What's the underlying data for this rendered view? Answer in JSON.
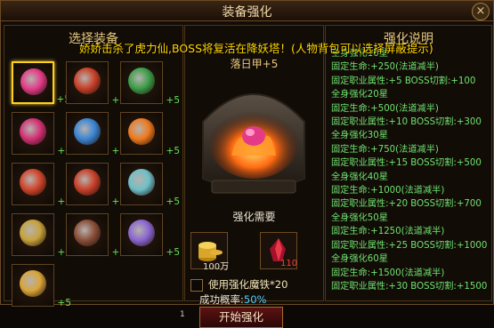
{
  "window": {
    "title": "装备强化",
    "close_label": "×"
  },
  "left_panel": {
    "title": "选择装备"
  },
  "notice": "娇娇击杀了虎力仙,BOSS将复活在降妖塔！(人物背包可以选择屏蔽提示)",
  "items": [
    {
      "icon": "pink-ring-icon",
      "level": "+5",
      "color": "#e43b88",
      "selected": true
    },
    {
      "icon": "red-bracelet-icon",
      "level": "+5",
      "color": "#c8412a",
      "selected": false
    },
    {
      "icon": "green-amulet-icon",
      "level": "+5",
      "color": "#3d9e4a",
      "selected": false
    },
    {
      "icon": "pink-necklace-icon",
      "level": "+5",
      "color": "#d33275",
      "selected": false
    },
    {
      "icon": "blue-orb-icon",
      "level": "+5",
      "color": "#3b86d4",
      "selected": false
    },
    {
      "icon": "flame-orb-icon",
      "level": "+5",
      "color": "#ef7a1f",
      "selected": false
    },
    {
      "icon": "red-bracelet-icon",
      "level": "+5",
      "color": "#d1452c",
      "selected": false
    },
    {
      "icon": "red-bracelet-icon",
      "level": "+5",
      "color": "#c8412a",
      "selected": false
    },
    {
      "icon": "ice-armor-icon",
      "level": "+5",
      "color": "#6fc0c8",
      "selected": false
    },
    {
      "icon": "gold-boots-icon",
      "level": "+5",
      "color": "#c7a23c",
      "selected": false
    },
    {
      "icon": "dark-boots-icon",
      "level": "+5",
      "color": "#8a4f3a",
      "selected": false
    },
    {
      "icon": "wing-helmet-icon",
      "level": "+5",
      "color": "#8b66d1",
      "selected": false
    },
    {
      "icon": "gold-weapon-icon",
      "level": "+5",
      "color": "#d9a53a",
      "selected": false
    }
  ],
  "middle_panel": {
    "tab_label": "落日甲+5",
    "need_label": "强化需要",
    "material_1": {
      "icon": "gold-coins-icon",
      "value": "100万",
      "value_color": "#e9e2d2"
    },
    "material_2": {
      "icon": "red-crystal-icon",
      "value": "110",
      "value_color": "#ff3b3b"
    },
    "checkbox_label": "使用强化魔铁*20",
    "rate_label": "成功概率:",
    "rate_value": "50%",
    "enhance_button": "开始强化",
    "index_label": "1"
  },
  "right_panel": {
    "title": "强化说明",
    "lines": [
      "全身强化10星",
      "固定生命:+250(法道减半)",
      "固定职业属性:+5    BOSS切割:+100",
      "全身强化20星",
      "固定生命:+500(法道减半)",
      "固定职业属性:+10   BOSS切割:+300",
      "全身强化30星",
      "固定生命:+750(法道减半)",
      "固定职业属性:+15   BOSS切割:+500",
      "全身强化40星",
      "固定生命:+1000(法道减半)",
      "固定职业属性:+20   BOSS切割:+700",
      "全身强化50星",
      "固定生命:+1250(法道减半)",
      "固定职业属性:+25   BOSS切割:+1000",
      "全身强化60星",
      "固定生命:+1500(法道减半)",
      "固定职业属性:+30   BOSS切割:+1500"
    ]
  }
}
